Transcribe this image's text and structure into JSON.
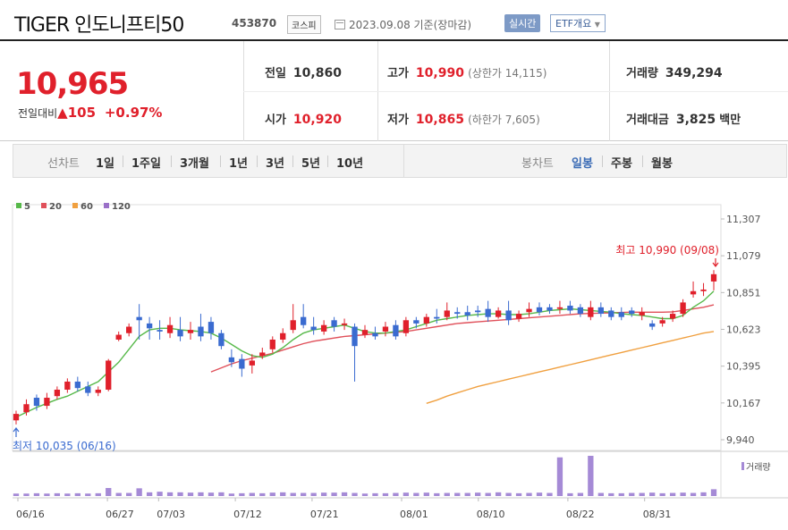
{
  "header": {
    "title": "TIGER 인도니프티50",
    "code": "453870",
    "market_badge": "코스피",
    "date_text": "2023.09.08 기준(장마감)",
    "live_badge": "실시간",
    "etf_badge": "ETF개요"
  },
  "price": {
    "current": "10,965",
    "change_label": "전일대비",
    "change_value": "105",
    "change_pct": "+0.97%"
  },
  "stats": {
    "prev_close_label": "전일",
    "prev_close": "10,860",
    "open_label": "시가",
    "open": "10,920",
    "high_label": "고가",
    "high": "10,990",
    "upper_limit": "(상한가 14,115)",
    "low_label": "저가",
    "low": "10,865",
    "lower_limit": "(하한가 7,605)",
    "volume_label": "거래량",
    "volume": "349,294",
    "amount_label": "거래대금",
    "amount": "3,825",
    "amount_unit": "백만"
  },
  "periods": {
    "label": "선차트",
    "items": [
      "1일",
      "1주일",
      "3개월",
      "1년",
      "3년",
      "5년",
      "10년"
    ],
    "candle_label": "봉차트",
    "candle_items": [
      "일봉",
      "주봉",
      "월봉"
    ],
    "candle_active": "일봉"
  },
  "colors": {
    "up": "#e0202b",
    "down": "#3a6bd0",
    "ma5": "#57b94a",
    "ma20": "#e0505a",
    "ma60": "#f0a040",
    "ma120": "#9a70c8",
    "volume": "#a58ad6"
  },
  "chart_data": {
    "type": "candlestick",
    "legend": [
      {
        "name": "5",
        "color": "#57b94a"
      },
      {
        "name": "20",
        "color": "#e0505a"
      },
      {
        "name": "60",
        "color": "#f0a040"
      },
      {
        "name": "120",
        "color": "#9a70c8"
      }
    ],
    "y_ticks": [
      "11,307",
      "11,079",
      "10,851",
      "10,623",
      "10,395",
      "10,167",
      "9,940"
    ],
    "ylim": [
      9940,
      11307
    ],
    "x_ticks": [
      "06/16",
      "06/27",
      "07/03",
      "07/12",
      "07/21",
      "08/01",
      "08/10",
      "08/22",
      "08/31"
    ],
    "high_note": "최고 10,990 (09/08)",
    "low_note": "최저 10,035 (06/16)",
    "volume_label": "거래량",
    "candles": [
      {
        "o": 10060,
        "c": 10100,
        "h": 10120,
        "l": 10035
      },
      {
        "o": 10110,
        "c": 10160,
        "h": 10190,
        "l": 10090
      },
      {
        "o": 10200,
        "c": 10150,
        "h": 10220,
        "l": 10120
      },
      {
        "o": 10150,
        "c": 10200,
        "h": 10230,
        "l": 10130
      },
      {
        "o": 10210,
        "c": 10250,
        "h": 10270,
        "l": 10190
      },
      {
        "o": 10250,
        "c": 10300,
        "h": 10320,
        "l": 10230
      },
      {
        "o": 10300,
        "c": 10260,
        "h": 10330,
        "l": 10240
      },
      {
        "o": 10270,
        "c": 10230,
        "h": 10300,
        "l": 10210
      },
      {
        "o": 10230,
        "c": 10250,
        "h": 10270,
        "l": 10210
      },
      {
        "o": 10250,
        "c": 10430,
        "h": 10440,
        "l": 10240
      },
      {
        "o": 10560,
        "c": 10590,
        "h": 10610,
        "l": 10550
      },
      {
        "o": 10600,
        "c": 10640,
        "h": 10660,
        "l": 10580
      },
      {
        "o": 10700,
        "c": 10680,
        "h": 10780,
        "l": 10560
      },
      {
        "o": 10660,
        "c": 10630,
        "h": 10700,
        "l": 10560
      },
      {
        "o": 10620,
        "c": 10610,
        "h": 10680,
        "l": 10560
      },
      {
        "o": 10600,
        "c": 10650,
        "h": 10700,
        "l": 10570
      },
      {
        "o": 10620,
        "c": 10580,
        "h": 10700,
        "l": 10550
      },
      {
        "o": 10600,
        "c": 10620,
        "h": 10670,
        "l": 10560
      },
      {
        "o": 10640,
        "c": 10580,
        "h": 10720,
        "l": 10550
      },
      {
        "o": 10670,
        "c": 10600,
        "h": 10700,
        "l": 10560
      },
      {
        "o": 10600,
        "c": 10520,
        "h": 10620,
        "l": 10500
      },
      {
        "o": 10450,
        "c": 10420,
        "h": 10500,
        "l": 10390
      },
      {
        "o": 10440,
        "c": 10380,
        "h": 10470,
        "l": 10330
      },
      {
        "o": 10400,
        "c": 10430,
        "h": 10470,
        "l": 10350
      },
      {
        "o": 10460,
        "c": 10480,
        "h": 10510,
        "l": 10440
      },
      {
        "o": 10500,
        "c": 10560,
        "h": 10580,
        "l": 10480
      },
      {
        "o": 10560,
        "c": 10600,
        "h": 10630,
        "l": 10540
      },
      {
        "o": 10620,
        "c": 10680,
        "h": 10780,
        "l": 10600
      },
      {
        "o": 10700,
        "c": 10650,
        "h": 10780,
        "l": 10630
      },
      {
        "o": 10640,
        "c": 10620,
        "h": 10700,
        "l": 10590
      },
      {
        "o": 10610,
        "c": 10650,
        "h": 10680,
        "l": 10590
      },
      {
        "o": 10680,
        "c": 10640,
        "h": 10700,
        "l": 10610
      },
      {
        "o": 10650,
        "c": 10660,
        "h": 10690,
        "l": 10620
      },
      {
        "o": 10640,
        "c": 10520,
        "h": 10660,
        "l": 10300
      },
      {
        "o": 10590,
        "c": 10620,
        "h": 10650,
        "l": 10570
      },
      {
        "o": 10600,
        "c": 10580,
        "h": 10640,
        "l": 10560
      },
      {
        "o": 10610,
        "c": 10640,
        "h": 10670,
        "l": 10580
      },
      {
        "o": 10650,
        "c": 10580,
        "h": 10680,
        "l": 10560
      },
      {
        "o": 10600,
        "c": 10680,
        "h": 10700,
        "l": 10580
      },
      {
        "o": 10680,
        "c": 10660,
        "h": 10700,
        "l": 10630
      },
      {
        "o": 10660,
        "c": 10700,
        "h": 10720,
        "l": 10640
      },
      {
        "o": 10700,
        "c": 10690,
        "h": 10750,
        "l": 10660
      },
      {
        "o": 10700,
        "c": 10740,
        "h": 10790,
        "l": 10680
      },
      {
        "o": 10730,
        "c": 10720,
        "h": 10760,
        "l": 10690
      },
      {
        "o": 10730,
        "c": 10710,
        "h": 10770,
        "l": 10680
      },
      {
        "o": 10740,
        "c": 10730,
        "h": 10770,
        "l": 10700
      },
      {
        "o": 10750,
        "c": 10700,
        "h": 10800,
        "l": 10670
      },
      {
        "o": 10700,
        "c": 10740,
        "h": 10760,
        "l": 10690
      },
      {
        "o": 10740,
        "c": 10680,
        "h": 10800,
        "l": 10650
      },
      {
        "o": 10690,
        "c": 10720,
        "h": 10740,
        "l": 10670
      },
      {
        "o": 10730,
        "c": 10750,
        "h": 10790,
        "l": 10700
      },
      {
        "o": 10760,
        "c": 10730,
        "h": 10790,
        "l": 10710
      },
      {
        "o": 10760,
        "c": 10740,
        "h": 10780,
        "l": 10720
      },
      {
        "o": 10750,
        "c": 10760,
        "h": 10800,
        "l": 10720
      },
      {
        "o": 10770,
        "c": 10740,
        "h": 10800,
        "l": 10720
      },
      {
        "o": 10760,
        "c": 10720,
        "h": 10780,
        "l": 10700
      },
      {
        "o": 10700,
        "c": 10760,
        "h": 10800,
        "l": 10680
      },
      {
        "o": 10760,
        "c": 10720,
        "h": 10790,
        "l": 10700
      },
      {
        "o": 10740,
        "c": 10700,
        "h": 10760,
        "l": 10680
      },
      {
        "o": 10730,
        "c": 10700,
        "h": 10760,
        "l": 10680
      },
      {
        "o": 10740,
        "c": 10720,
        "h": 10760,
        "l": 10700
      },
      {
        "o": 10710,
        "c": 10730,
        "h": 10760,
        "l": 10680
      },
      {
        "o": 10660,
        "c": 10640,
        "h": 10680,
        "l": 10620
      },
      {
        "o": 10660,
        "c": 10680,
        "h": 10700,
        "l": 10640
      },
      {
        "o": 10690,
        "c": 10720,
        "h": 10740,
        "l": 10670
      },
      {
        "o": 10720,
        "c": 10790,
        "h": 10810,
        "l": 10700
      },
      {
        "o": 10840,
        "c": 10860,
        "h": 10920,
        "l": 10820
      },
      {
        "o": 10860,
        "c": 10870,
        "h": 10910,
        "l": 10830
      },
      {
        "o": 10920,
        "c": 10965,
        "h": 10990,
        "l": 10865
      }
    ],
    "ma5": [
      10080,
      10110,
      10140,
      10165,
      10190,
      10210,
      10240,
      10270,
      10300,
      10360,
      10420,
      10500,
      10580,
      10620,
      10630,
      10630,
      10620,
      10615,
      10610,
      10600,
      10570,
      10530,
      10490,
      10460,
      10450,
      10470,
      10510,
      10560,
      10600,
      10620,
      10630,
      10640,
      10650,
      10630,
      10610,
      10600,
      10600,
      10610,
      10620,
      10640,
      10660,
      10680,
      10690,
      10700,
      10710,
      10715,
      10720,
      10720,
      10715,
      10715,
      10720,
      10730,
      10740,
      10745,
      10750,
      10745,
      10740,
      10735,
      10730,
      10720,
      10715,
      10710,
      10700,
      10690,
      10690,
      10710,
      10760,
      10800,
      10860
    ],
    "ma20": [
      null,
      null,
      null,
      null,
      null,
      null,
      null,
      null,
      null,
      null,
      null,
      null,
      null,
      null,
      null,
      null,
      null,
      null,
      null,
      10360,
      10385,
      10410,
      10430,
      10445,
      10460,
      10475,
      10495,
      10515,
      10535,
      10550,
      10560,
      10570,
      10580,
      10585,
      10590,
      10595,
      10600,
      10605,
      10610,
      10620,
      10630,
      10640,
      10650,
      10660,
      10665,
      10670,
      10675,
      10680,
      10685,
      10690,
      10695,
      10700,
      10705,
      10710,
      10715,
      10720,
      10722,
      10724,
      10726,
      10728,
      10730,
      10730,
      10730,
      10730,
      10732,
      10740,
      10750,
      10760,
      10775
    ],
    "ma60": [
      null,
      null,
      null,
      null,
      null,
      null,
      null,
      null,
      null,
      null,
      null,
      null,
      null,
      null,
      null,
      null,
      null,
      null,
      null,
      null,
      null,
      null,
      null,
      null,
      null,
      null,
      null,
      null,
      null,
      null,
      null,
      null,
      null,
      null,
      null,
      null,
      null,
      null,
      null,
      null,
      10165,
      10185,
      10210,
      10230,
      10250,
      10270,
      10285,
      10300,
      10315,
      10330,
      10345,
      10360,
      10375,
      10390,
      10405,
      10420,
      10435,
      10450,
      10465,
      10480,
      10495,
      10510,
      10525,
      10540,
      10555,
      10570,
      10585,
      10600,
      10610
    ],
    "volume": [
      8,
      8,
      9,
      8,
      9,
      8,
      9,
      8,
      9,
      26,
      10,
      10,
      25,
      12,
      14,
      12,
      12,
      11,
      12,
      11,
      12,
      8,
      9,
      10,
      9,
      11,
      12,
      10,
      10,
      10,
      11,
      11,
      12,
      10,
      8,
      9,
      9,
      10,
      11,
      10,
      11,
      9,
      10,
      10,
      10,
      11,
      10,
      12,
      10,
      9,
      10,
      11,
      10,
      125,
      9,
      10,
      130,
      10,
      9,
      9,
      10,
      10,
      11,
      9,
      10,
      11,
      10,
      12,
      22
    ]
  }
}
